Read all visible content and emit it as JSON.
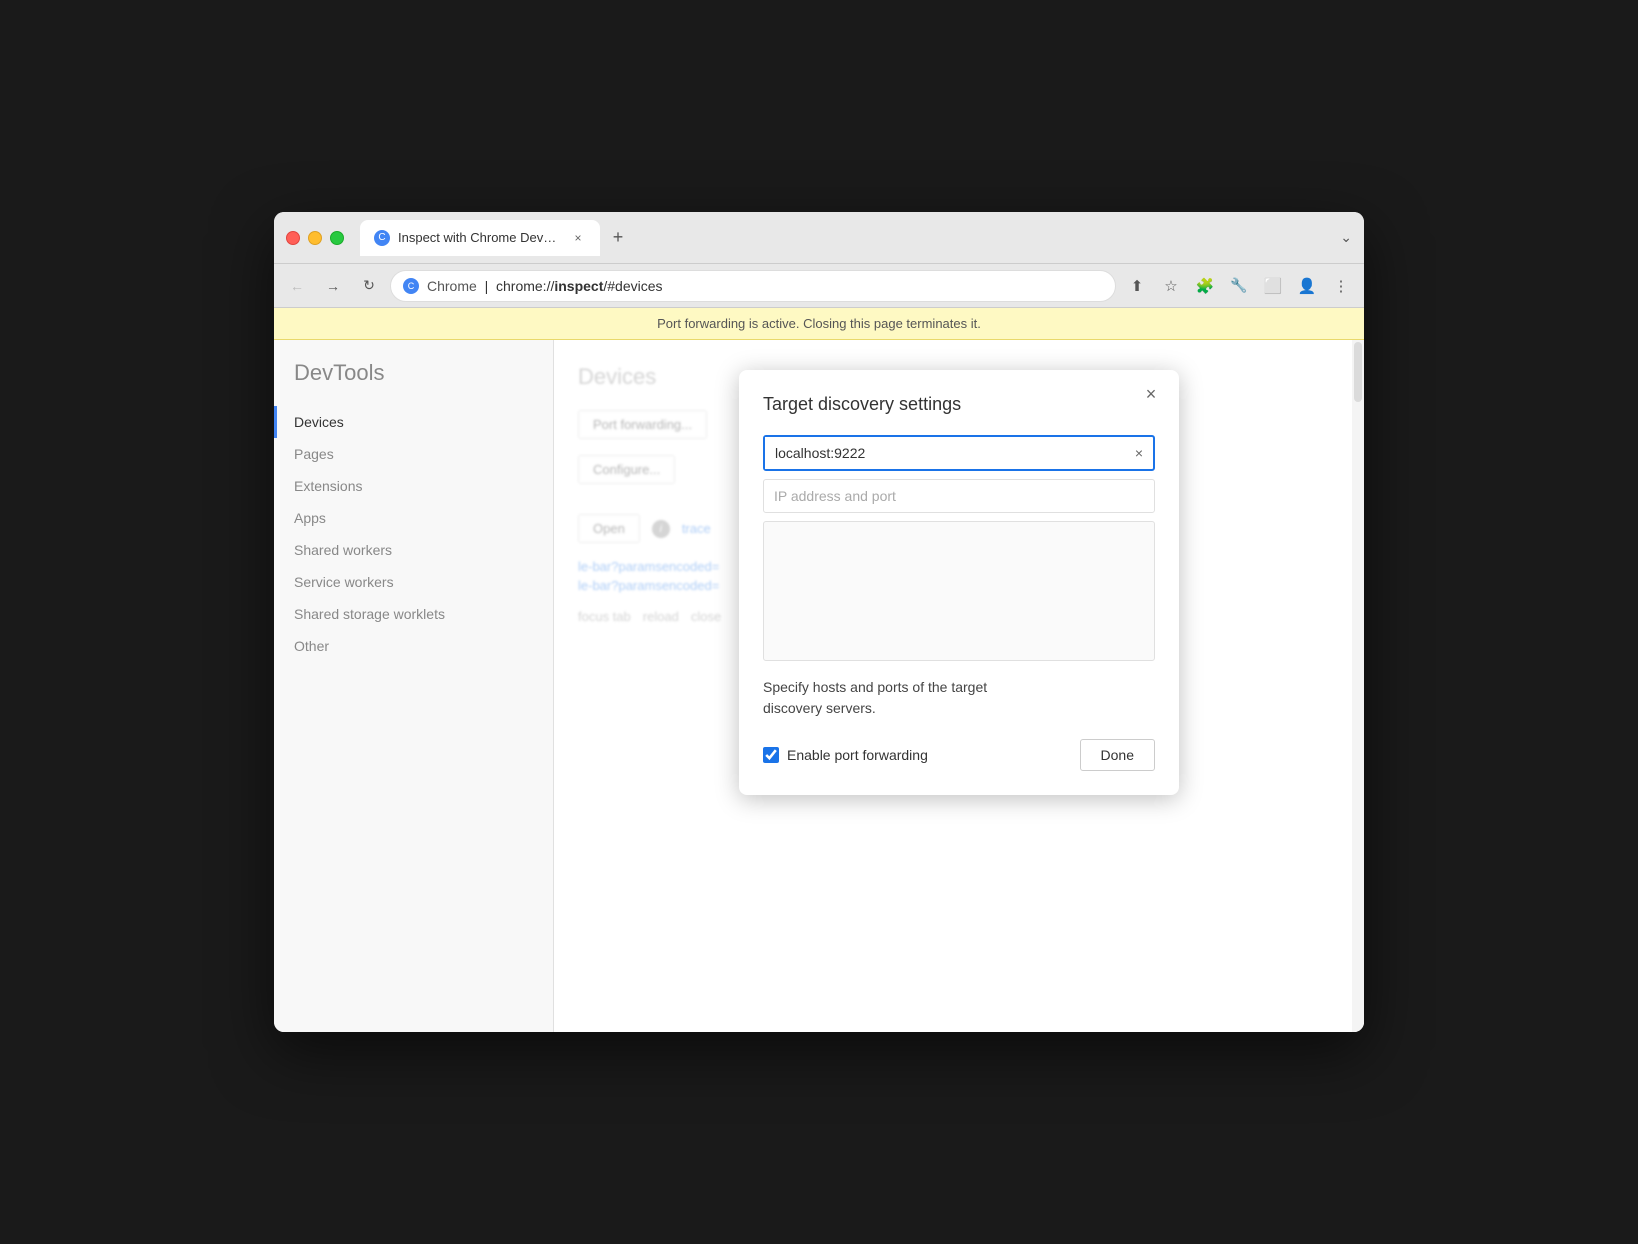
{
  "browser": {
    "tab": {
      "favicon": "C",
      "title": "Inspect with Chrome Develope",
      "close_label": "×"
    },
    "new_tab_label": "+",
    "chevron_label": "⌄",
    "nav": {
      "back_label": "←",
      "forward_label": "→",
      "reload_label": "↻"
    },
    "url": {
      "protocol": "Chrome",
      "full": "chrome://inspect/#devices",
      "bold_part": "inspect",
      "site_icon": "C"
    },
    "toolbar": {
      "share_icon": "⬆",
      "bookmark_icon": "☆",
      "extensions_icon": "🧩",
      "devtools_icon": "🔧",
      "split_icon": "⬜",
      "profile_icon": "👤",
      "menu_icon": "⋮"
    }
  },
  "warning_banner": {
    "text": "Port forwarding is active. Closing this page terminates it."
  },
  "sidebar": {
    "title": "DevTools",
    "items": [
      {
        "label": "Devices",
        "active": true
      },
      {
        "label": "Pages",
        "active": false
      },
      {
        "label": "Extensions",
        "active": false
      },
      {
        "label": "Apps",
        "active": false
      },
      {
        "label": "Shared workers",
        "active": false
      },
      {
        "label": "Service workers",
        "active": false
      },
      {
        "label": "Shared storage worklets",
        "active": false
      },
      {
        "label": "Other",
        "active": false
      }
    ]
  },
  "content": {
    "page_title": "Devices",
    "forwarding_button_label": "Port forwarding...",
    "configure_button_label": "Configure...",
    "open_button_label": "Open",
    "trace_link_label": "trace",
    "url_text1": "le-bar?paramsencoded=",
    "url_text2": "le-bar?paramsencoded=",
    "focus_tab_label": "focus tab",
    "reload_label": "reload",
    "close_label": "close"
  },
  "modal": {
    "title": "Target discovery settings",
    "close_label": "×",
    "input_value": "localhost:9222",
    "input_clear_label": "×",
    "placeholder_text": "IP address and port",
    "description": "Specify hosts and ports of the target\ndiscovery servers.",
    "checkbox": {
      "label": "Enable port forwarding",
      "checked": true
    },
    "done_button_label": "Done"
  }
}
